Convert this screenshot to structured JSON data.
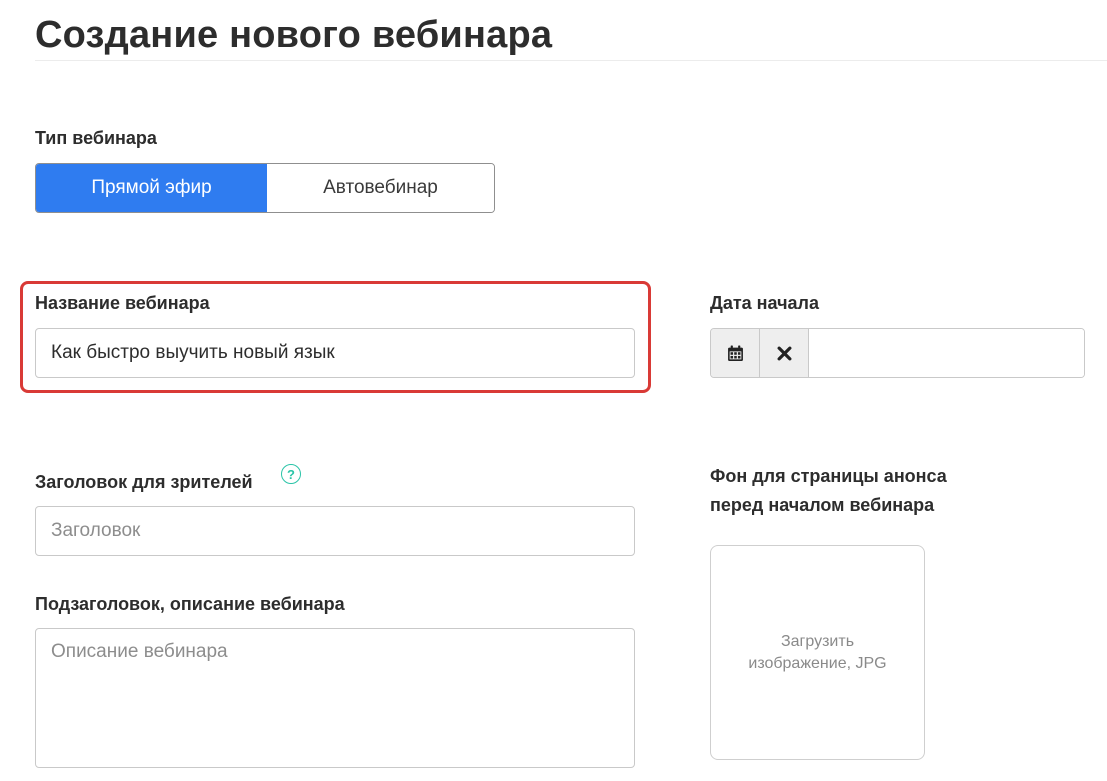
{
  "page": {
    "title": "Создание нового вебинара"
  },
  "webinar_type": {
    "label": "Тип вебинара",
    "options": [
      "Прямой эфир",
      "Автовебинар"
    ],
    "selected": "Прямой эфир"
  },
  "webinar_name": {
    "label": "Название вебинара",
    "value": "Как быстро выучить новый язык"
  },
  "start_date": {
    "label": "Дата начала",
    "value": "",
    "calendar_icon": "calendar-icon",
    "clear_icon": "close-icon"
  },
  "viewer_title": {
    "label": "Заголовок для зрителей",
    "placeholder": "Заголовок",
    "help_icon": "?"
  },
  "subtitle": {
    "label": "Подзаголовок, описание вебинара",
    "placeholder": "Описание вебинара"
  },
  "background": {
    "label_line1": "Фон для страницы анонса",
    "label_line2": "перед началом вебинара",
    "upload_text": "Загрузить изображение, JPG"
  },
  "colors": {
    "accent": "#2f7cf0",
    "highlight": "#d93a36",
    "help": "#2bc4a8"
  }
}
